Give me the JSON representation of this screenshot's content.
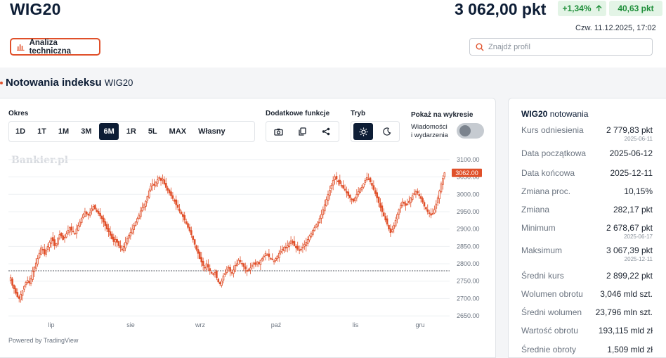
{
  "header": {
    "title": "WIG20",
    "price": "3 062,00 pkt",
    "change_pct": "+1,34%",
    "change_abs": "40,63 pkt",
    "timestamp": "Czw. 11.12.2025, 17:02",
    "ta_button": "Analiza techniczna",
    "search_placeholder": "Znajdź profil",
    "up_color": "#1f8f3a",
    "accent": "#e0502a"
  },
  "section": {
    "title": "Notowania indeksu",
    "subtitle": "WIG20"
  },
  "controls": {
    "period_label": "Okres",
    "periods": [
      "1D",
      "1T",
      "1M",
      "3M",
      "6M",
      "1R",
      "5L",
      "MAX",
      "Własny"
    ],
    "active_period": "6M",
    "extra_label": "Dodatkowe funkcje",
    "mode_label": "Tryb",
    "show_label": "Pokaż na wykresie",
    "toggle_label_1": "Wiadomości",
    "toggle_label_2": "i wydarzenia",
    "toggle_on": false
  },
  "chart": {
    "watermark": "Bankier.pl",
    "powered_by": "Powered by TradingView",
    "last_price_label": "3062.00"
  },
  "chart_data": {
    "type": "candlestick",
    "y_ticks": [
      "3100.00",
      "3050.00",
      "3000.00",
      "2950.00",
      "2900.00",
      "2850.00",
      "2800.00",
      "2750.00",
      "2700.00",
      "2650.00"
    ],
    "ylim": [
      2640,
      3110
    ],
    "x_ticks": [
      "lip",
      "sie",
      "wrz",
      "paź",
      "lis",
      "gru"
    ],
    "reference_line": 2779.83,
    "last_price": 3062.0,
    "closes": [
      2760,
      2738,
      2728,
      2715,
      2705,
      2700,
      2712,
      2722,
      2735,
      2746,
      2752,
      2745,
      2758,
      2778,
      2790,
      2802,
      2815,
      2830,
      2846,
      2840,
      2828,
      2838,
      2850,
      2862,
      2872,
      2866,
      2852,
      2858,
      2872,
      2884,
      2880,
      2870,
      2876,
      2886,
      2896,
      2904,
      2897,
      2892,
      2886,
      2900,
      2910,
      2920,
      2930,
      2942,
      2950,
      2944,
      2940,
      2948,
      2958,
      2965,
      2958,
      2950,
      2945,
      2938,
      2930,
      2920,
      2910,
      2900,
      2892,
      2882,
      2872,
      2864,
      2870,
      2862,
      2852,
      2846,
      2840,
      2850,
      2862,
      2872,
      2882,
      2890,
      2900,
      2910,
      2920,
      2930,
      2940,
      2952,
      2962,
      2970,
      2980,
      2994,
      3010,
      3024,
      3030,
      3026,
      3035,
      3042,
      3048,
      3040,
      3044,
      3030,
      3020,
      3012,
      3004,
      2996,
      2988,
      2980,
      2970,
      2962,
      2952,
      2944,
      2936,
      2926,
      2916,
      2905,
      2895,
      2884,
      2870,
      2856,
      2842,
      2830,
      2815,
      2805,
      2795,
      2788,
      2800,
      2790,
      2780,
      2773,
      2770,
      2775,
      2760,
      2748,
      2742,
      2750,
      2765,
      2772,
      2785,
      2790,
      2778,
      2775,
      2782,
      2795,
      2800,
      2810,
      2806,
      2800,
      2792,
      2785,
      2778,
      2783,
      2788,
      2796,
      2802,
      2798,
      2805,
      2800,
      2810,
      2815,
      2822,
      2830,
      2826,
      2820,
      2816,
      2812,
      2808,
      2815,
      2822,
      2830,
      2836,
      2842,
      2848,
      2845,
      2852,
      2860,
      2866,
      2860,
      2852,
      2846,
      2842,
      2838,
      2842,
      2848,
      2856,
      2862,
      2870,
      2880,
      2888,
      2896,
      2904,
      2912,
      2920,
      2930,
      2942,
      2956,
      2970,
      2985,
      3000,
      3012,
      3026,
      3040,
      3050,
      3044,
      3036,
      3030,
      3024,
      3018,
      3012,
      3004,
      2996,
      2990,
      2985,
      2980,
      2990,
      3000,
      3008,
      3016,
      3020,
      3030,
      3040,
      3048,
      3044,
      3036,
      3026,
      3014,
      3002,
      2990,
      2976,
      2962,
      2950,
      2938,
      2926,
      2914,
      2900,
      2890,
      2898,
      2910,
      2925,
      2942,
      2956,
      2968,
      2978,
      2974,
      2968,
      2972,
      2980,
      2990,
      2996,
      3002,
      3008,
      3004,
      2996,
      2988,
      2978,
      2966,
      2958,
      2950,
      2946,
      2940,
      2944,
      2956,
      2972,
      2990,
      3010,
      3030,
      3046,
      3062
    ]
  },
  "stats": {
    "title_bold": "WIG20",
    "title_rest": "notowania",
    "rows": [
      {
        "k": "Kurs odniesienia",
        "v": "2 779,83 pkt",
        "d": "2025-06-11"
      },
      {
        "k": "Data początkowa",
        "v": "2025-06-12",
        "d": ""
      },
      {
        "k": "Data końcowa",
        "v": "2025-12-11",
        "d": ""
      },
      {
        "k": "Zmiana proc.",
        "v": "10,15%",
        "d": ""
      },
      {
        "k": "Zmiana",
        "v": "282,17 pkt",
        "d": ""
      },
      {
        "k": "Minimum",
        "v": "2 678,67 pkt",
        "d": "2025-06-17"
      },
      {
        "k": "Maksimum",
        "v": "3 067,39 pkt",
        "d": "2025-12-11"
      },
      {
        "k": "Średni kurs",
        "v": "2 899,22 pkt",
        "d": ""
      },
      {
        "k": "Wolumen obrotu",
        "v": "3,046 mld szt.",
        "d": ""
      },
      {
        "k": "Średni wolumen",
        "v": "23,796 mln szt.",
        "d": ""
      },
      {
        "k": "Wartość obrotu",
        "v": "193,115 mld zł",
        "d": ""
      },
      {
        "k": "Średnie obroty",
        "v": "1,509 mld zł",
        "d": ""
      }
    ]
  }
}
